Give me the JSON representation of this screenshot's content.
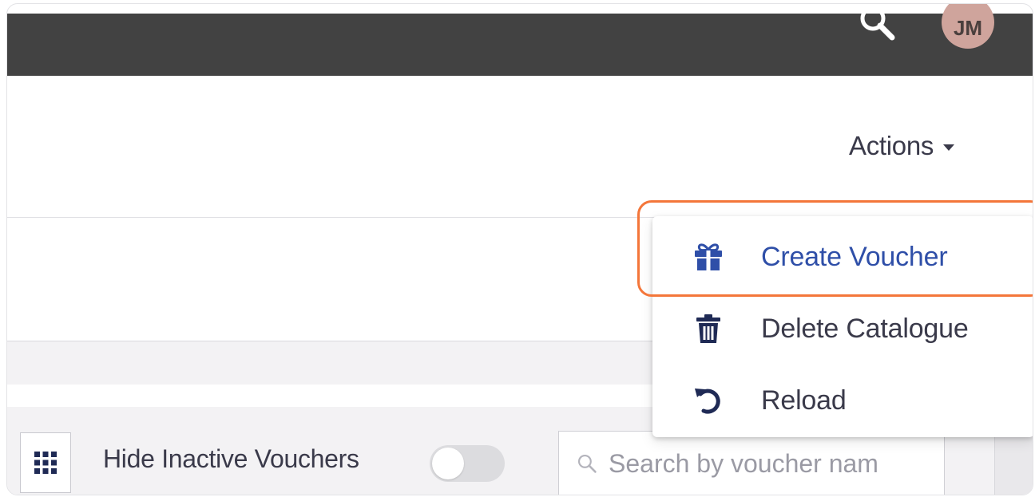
{
  "topbar": {
    "search_icon": "search-icon",
    "avatar_initials": "JM",
    "background_color": "#424242"
  },
  "header": {
    "actions_label": "Actions",
    "actions_icon": "caret-down-icon"
  },
  "actions_menu": {
    "items": [
      {
        "label": "Create Voucher",
        "icon": "gift-icon",
        "highlighted": true,
        "color": "#2f4fa8"
      },
      {
        "label": "Delete Catalogue",
        "icon": "trash-icon",
        "highlighted": false
      },
      {
        "label": "Reload",
        "icon": "reload-icon",
        "highlighted": false
      }
    ],
    "highlight_color": "#f4763a"
  },
  "toolbar": {
    "grid_view_icon": "grid-icon",
    "hide_inactive_label": "Hide Inactive Vouchers",
    "hide_inactive_enabled": false,
    "search_placeholder": "Search by voucher nam",
    "search_value": ""
  }
}
